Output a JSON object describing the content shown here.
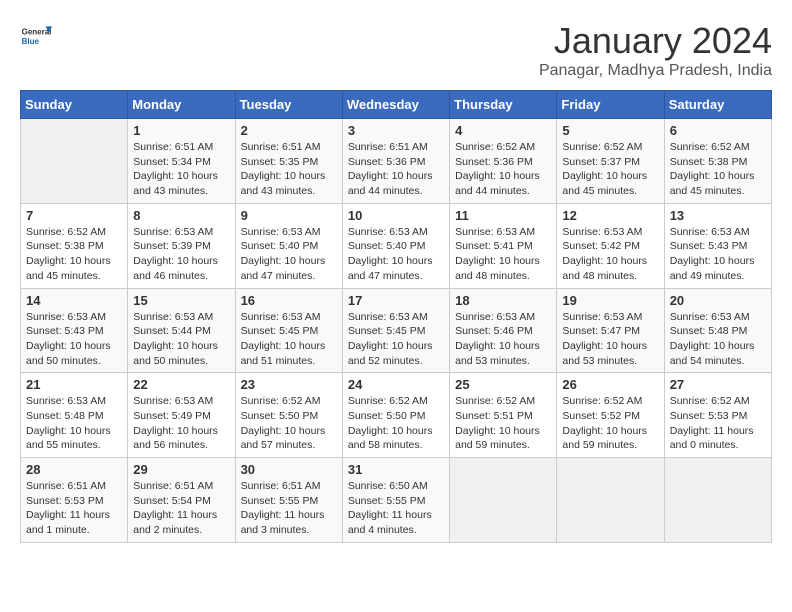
{
  "logo": {
    "general": "General",
    "blue": "Blue"
  },
  "title": "January 2024",
  "subtitle": "Panagar, Madhya Pradesh, India",
  "days_of_week": [
    "Sunday",
    "Monday",
    "Tuesday",
    "Wednesday",
    "Thursday",
    "Friday",
    "Saturday"
  ],
  "weeks": [
    [
      {
        "num": "",
        "info": ""
      },
      {
        "num": "1",
        "info": "Sunrise: 6:51 AM\nSunset: 5:34 PM\nDaylight: 10 hours\nand 43 minutes."
      },
      {
        "num": "2",
        "info": "Sunrise: 6:51 AM\nSunset: 5:35 PM\nDaylight: 10 hours\nand 43 minutes."
      },
      {
        "num": "3",
        "info": "Sunrise: 6:51 AM\nSunset: 5:36 PM\nDaylight: 10 hours\nand 44 minutes."
      },
      {
        "num": "4",
        "info": "Sunrise: 6:52 AM\nSunset: 5:36 PM\nDaylight: 10 hours\nand 44 minutes."
      },
      {
        "num": "5",
        "info": "Sunrise: 6:52 AM\nSunset: 5:37 PM\nDaylight: 10 hours\nand 45 minutes."
      },
      {
        "num": "6",
        "info": "Sunrise: 6:52 AM\nSunset: 5:38 PM\nDaylight: 10 hours\nand 45 minutes."
      }
    ],
    [
      {
        "num": "7",
        "info": "Sunrise: 6:52 AM\nSunset: 5:38 PM\nDaylight: 10 hours\nand 45 minutes."
      },
      {
        "num": "8",
        "info": "Sunrise: 6:53 AM\nSunset: 5:39 PM\nDaylight: 10 hours\nand 46 minutes."
      },
      {
        "num": "9",
        "info": "Sunrise: 6:53 AM\nSunset: 5:40 PM\nDaylight: 10 hours\nand 47 minutes."
      },
      {
        "num": "10",
        "info": "Sunrise: 6:53 AM\nSunset: 5:40 PM\nDaylight: 10 hours\nand 47 minutes."
      },
      {
        "num": "11",
        "info": "Sunrise: 6:53 AM\nSunset: 5:41 PM\nDaylight: 10 hours\nand 48 minutes."
      },
      {
        "num": "12",
        "info": "Sunrise: 6:53 AM\nSunset: 5:42 PM\nDaylight: 10 hours\nand 48 minutes."
      },
      {
        "num": "13",
        "info": "Sunrise: 6:53 AM\nSunset: 5:43 PM\nDaylight: 10 hours\nand 49 minutes."
      }
    ],
    [
      {
        "num": "14",
        "info": "Sunrise: 6:53 AM\nSunset: 5:43 PM\nDaylight: 10 hours\nand 50 minutes."
      },
      {
        "num": "15",
        "info": "Sunrise: 6:53 AM\nSunset: 5:44 PM\nDaylight: 10 hours\nand 50 minutes."
      },
      {
        "num": "16",
        "info": "Sunrise: 6:53 AM\nSunset: 5:45 PM\nDaylight: 10 hours\nand 51 minutes."
      },
      {
        "num": "17",
        "info": "Sunrise: 6:53 AM\nSunset: 5:45 PM\nDaylight: 10 hours\nand 52 minutes."
      },
      {
        "num": "18",
        "info": "Sunrise: 6:53 AM\nSunset: 5:46 PM\nDaylight: 10 hours\nand 53 minutes."
      },
      {
        "num": "19",
        "info": "Sunrise: 6:53 AM\nSunset: 5:47 PM\nDaylight: 10 hours\nand 53 minutes."
      },
      {
        "num": "20",
        "info": "Sunrise: 6:53 AM\nSunset: 5:48 PM\nDaylight: 10 hours\nand 54 minutes."
      }
    ],
    [
      {
        "num": "21",
        "info": "Sunrise: 6:53 AM\nSunset: 5:48 PM\nDaylight: 10 hours\nand 55 minutes."
      },
      {
        "num": "22",
        "info": "Sunrise: 6:53 AM\nSunset: 5:49 PM\nDaylight: 10 hours\nand 56 minutes."
      },
      {
        "num": "23",
        "info": "Sunrise: 6:52 AM\nSunset: 5:50 PM\nDaylight: 10 hours\nand 57 minutes."
      },
      {
        "num": "24",
        "info": "Sunrise: 6:52 AM\nSunset: 5:50 PM\nDaylight: 10 hours\nand 58 minutes."
      },
      {
        "num": "25",
        "info": "Sunrise: 6:52 AM\nSunset: 5:51 PM\nDaylight: 10 hours\nand 59 minutes."
      },
      {
        "num": "26",
        "info": "Sunrise: 6:52 AM\nSunset: 5:52 PM\nDaylight: 10 hours\nand 59 minutes."
      },
      {
        "num": "27",
        "info": "Sunrise: 6:52 AM\nSunset: 5:53 PM\nDaylight: 11 hours\nand 0 minutes."
      }
    ],
    [
      {
        "num": "28",
        "info": "Sunrise: 6:51 AM\nSunset: 5:53 PM\nDaylight: 11 hours\nand 1 minute."
      },
      {
        "num": "29",
        "info": "Sunrise: 6:51 AM\nSunset: 5:54 PM\nDaylight: 11 hours\nand 2 minutes."
      },
      {
        "num": "30",
        "info": "Sunrise: 6:51 AM\nSunset: 5:55 PM\nDaylight: 11 hours\nand 3 minutes."
      },
      {
        "num": "31",
        "info": "Sunrise: 6:50 AM\nSunset: 5:55 PM\nDaylight: 11 hours\nand 4 minutes."
      },
      {
        "num": "",
        "info": ""
      },
      {
        "num": "",
        "info": ""
      },
      {
        "num": "",
        "info": ""
      }
    ]
  ]
}
